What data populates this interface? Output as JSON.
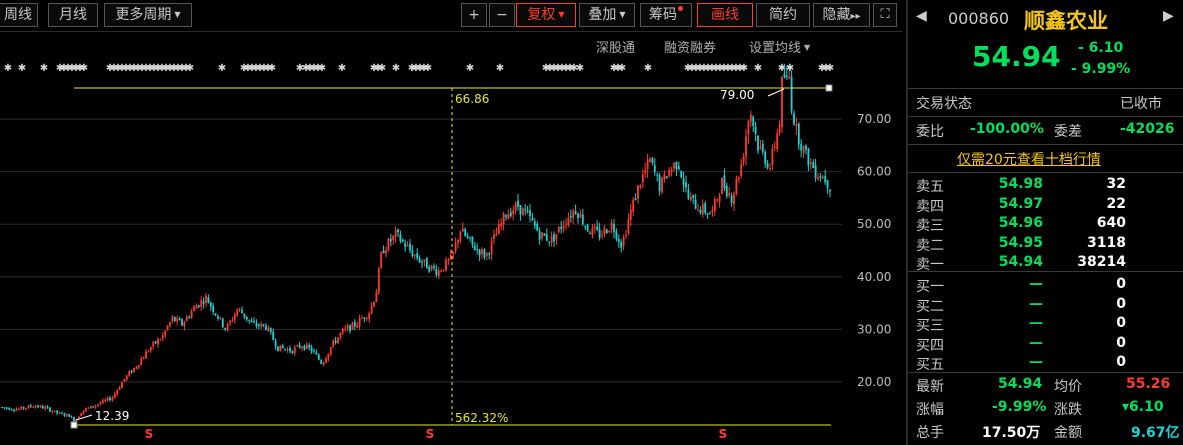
{
  "toolbar": {
    "weekly": "周线",
    "monthly": "月线",
    "more_periods": "更多周期",
    "plus": "+",
    "minus": "−",
    "restore_rights": "复权",
    "overlay": "叠加",
    "chips": "筹码",
    "draw_line": "画线",
    "simple": "简约",
    "hide": "隐藏",
    "hide_arrows": "▸▸",
    "expand_icon": "⛶"
  },
  "subbar": {
    "sh_hk_connect": "深股通",
    "margin": "融资融券",
    "ma_settings": "设置均线"
  },
  "chart": {
    "y_ticks": [
      "70.00",
      "60.00",
      "50.00",
      "40.00",
      "30.00",
      "20.00"
    ],
    "high_label": "79.00",
    "low_label": "12.39",
    "cursor_price": "66.86",
    "cursor_pct": "562.32%",
    "marker_s": "S"
  },
  "chart_data": {
    "type": "candlestick",
    "title": "",
    "y_ticks": [
      70,
      60,
      50,
      40,
      30,
      20
    ],
    "ylim": [
      8,
      82
    ],
    "max_price": 79.0,
    "min_price": 12.39,
    "cursor": {
      "price": 66.86,
      "change_pct": "562.32%"
    },
    "up_color": "#ff3b2f",
    "down_color": "#19d6d6",
    "waypoints": [
      [
        0,
        15.2
      ],
      [
        18,
        14.8
      ],
      [
        34,
        15.5
      ],
      [
        46,
        15.0
      ],
      [
        58,
        14.0
      ],
      [
        70,
        13.6
      ],
      [
        74,
        12.4
      ],
      [
        82,
        14.5
      ],
      [
        96,
        15.6
      ],
      [
        112,
        17.0
      ],
      [
        124,
        20.5
      ],
      [
        136,
        23.0
      ],
      [
        150,
        26.5
      ],
      [
        162,
        28.5
      ],
      [
        172,
        32.0
      ],
      [
        182,
        31.0
      ],
      [
        196,
        34.5
      ],
      [
        206,
        36.0
      ],
      [
        216,
        33.0
      ],
      [
        226,
        30.0
      ],
      [
        238,
        34.0
      ],
      [
        252,
        31.0
      ],
      [
        266,
        30.5
      ],
      [
        278,
        26.5
      ],
      [
        292,
        26.0
      ],
      [
        302,
        27.0
      ],
      [
        312,
        26.0
      ],
      [
        322,
        23.5
      ],
      [
        332,
        27.0
      ],
      [
        342,
        29.5
      ],
      [
        356,
        31.0
      ],
      [
        370,
        33.5
      ],
      [
        376,
        37.0
      ],
      [
        382,
        45.0
      ],
      [
        396,
        48.0
      ],
      [
        410,
        45.0
      ],
      [
        424,
        42.5
      ],
      [
        438,
        41.0
      ],
      [
        452,
        43.5
      ],
      [
        460,
        49.0
      ],
      [
        472,
        46.0
      ],
      [
        486,
        44.0
      ],
      [
        496,
        48.0
      ],
      [
        506,
        52.0
      ],
      [
        518,
        53.5
      ],
      [
        530,
        51.0
      ],
      [
        540,
        48.0
      ],
      [
        552,
        47.0
      ],
      [
        566,
        51.0
      ],
      [
        576,
        53.0
      ],
      [
        588,
        49.0
      ],
      [
        600,
        48.0
      ],
      [
        612,
        50.0
      ],
      [
        622,
        46.0
      ],
      [
        630,
        52.0
      ],
      [
        640,
        58.0
      ],
      [
        650,
        62.0
      ],
      [
        660,
        57.0
      ],
      [
        668,
        60.0
      ],
      [
        678,
        62.0
      ],
      [
        688,
        55.0
      ],
      [
        700,
        53.0
      ],
      [
        712,
        52.0
      ],
      [
        722,
        58.0
      ],
      [
        732,
        55.0
      ],
      [
        742,
        62.0
      ],
      [
        750,
        72.0
      ],
      [
        758,
        65.0
      ],
      [
        770,
        61.0
      ],
      [
        780,
        70.0
      ],
      [
        786,
        79.0
      ],
      [
        796,
        68.0
      ],
      [
        806,
        63.0
      ],
      [
        816,
        60.0
      ],
      [
        824,
        59.0
      ],
      [
        831,
        57.0
      ]
    ]
  },
  "quote": {
    "code": "000860",
    "name": "顺鑫农业",
    "price": "54.94",
    "change": "- 6.10",
    "change_pct": "- 9.99%",
    "trade_status_label": "交易状态",
    "trade_status": "已收市",
    "weibi_label": "委比",
    "weibi": "-100.00%",
    "weicha_label": "委差",
    "weicha": "-42026",
    "promo": "仅需20元查看十档行情",
    "asks": [
      {
        "label": "卖五",
        "price": "54.98",
        "vol": "32"
      },
      {
        "label": "卖四",
        "price": "54.97",
        "vol": "22"
      },
      {
        "label": "卖三",
        "price": "54.96",
        "vol": "640"
      },
      {
        "label": "卖二",
        "price": "54.95",
        "vol": "3118"
      },
      {
        "label": "卖一",
        "price": "54.94",
        "vol": "38214"
      }
    ],
    "bids": [
      {
        "label": "买一",
        "price": "—",
        "vol": "0"
      },
      {
        "label": "买二",
        "price": "—",
        "vol": "0"
      },
      {
        "label": "买三",
        "price": "—",
        "vol": "0"
      },
      {
        "label": "买四",
        "price": "—",
        "vol": "0"
      },
      {
        "label": "买五",
        "price": "—",
        "vol": "0"
      }
    ],
    "latest_label": "最新",
    "latest": "54.94",
    "avg_label": "均价",
    "avg": "55.26",
    "chg_pct_label": "涨幅",
    "chg_pct": "-9.99%",
    "chg_label": "涨跌",
    "chg": "▾6.10",
    "turnover_label": "总手",
    "turnover": "17.50万",
    "amount_label": "金额",
    "amount": "9.67亿"
  }
}
